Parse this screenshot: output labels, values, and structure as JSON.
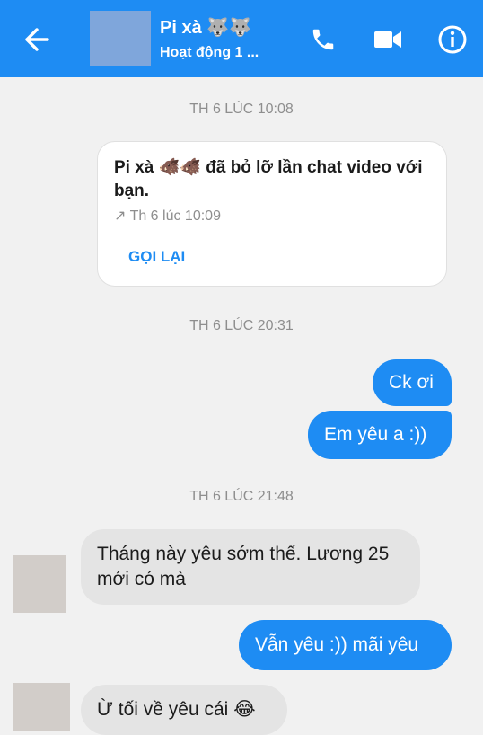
{
  "header": {
    "title": "Pi xà 🐺🐺",
    "subtitle": "Hoạt động 1 ..."
  },
  "timestamps": {
    "t1": "TH 6 LÚC 10:08",
    "t2": "TH 6 LÚC 20:31",
    "t3": "TH 6 LÚC 21:48"
  },
  "missed_call": {
    "text": "Pi xà 🐗🐗 đã bỏ lỡ lần chat video với bạn.",
    "time": "↗ Th 6 lúc 10:09",
    "callback_label": "GỌI LẠI"
  },
  "messages": {
    "m1": "Ck ơi",
    "m2": "Em yêu a :))",
    "m3": "Tháng này yêu sớm thế. Lương 25 mới có mà",
    "m4": "Vẫn yêu :)) mãi yêu",
    "m5": "Ừ tối về yêu cái 😂"
  },
  "colors": {
    "accent": "#1e8cf3",
    "incoming_bubble": "#e4e4e4",
    "background": "#f1f1f1"
  }
}
